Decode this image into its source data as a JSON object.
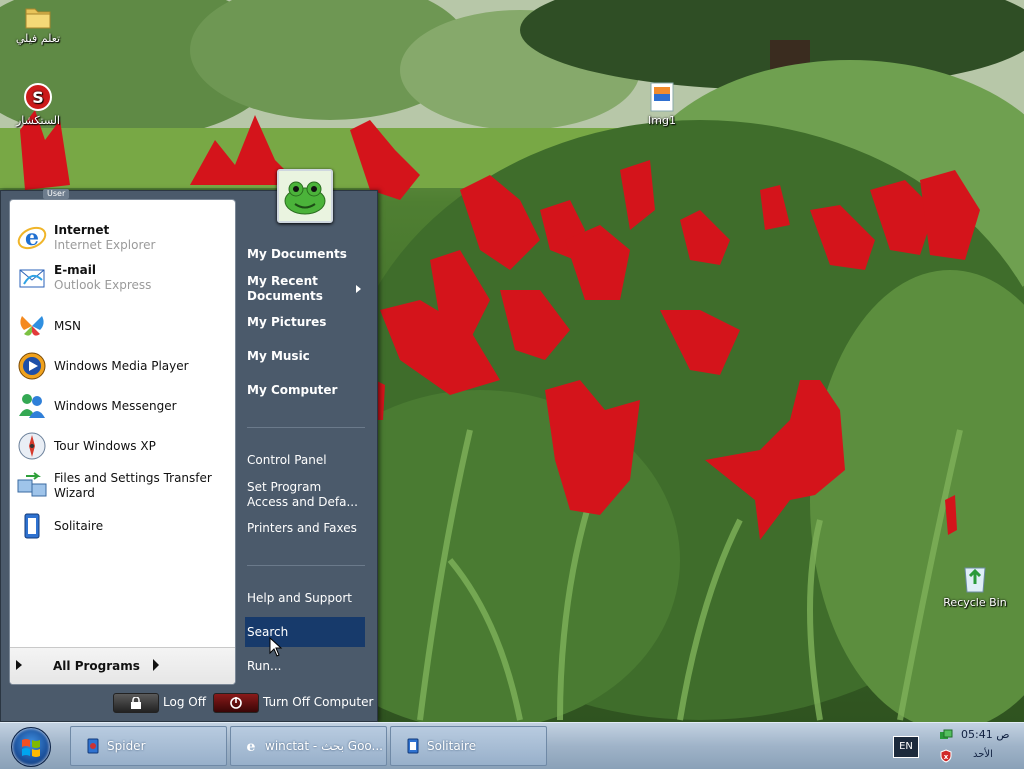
{
  "desktop": {
    "icons": [
      {
        "label": "تعلم فيلي",
        "icon": "folder-icon"
      },
      {
        "label": "الستكشار",
        "icon": "spider-app-icon"
      },
      {
        "label": "Img1",
        "icon": "image-file-icon"
      },
      {
        "label": "Recycle Bin",
        "icon": "recycle-bin-icon"
      }
    ]
  },
  "start_menu": {
    "user_name": "User",
    "pinned": [
      {
        "title": "Internet",
        "subtitle": "Internet Explorer",
        "icon": "internet-explorer-icon"
      },
      {
        "title": "E-mail",
        "subtitle": "Outlook Express",
        "icon": "outlook-express-icon"
      }
    ],
    "recent": [
      {
        "label": "MSN",
        "icon": "msn-butterfly-icon"
      },
      {
        "label": "Windows Media Player",
        "icon": "media-player-icon"
      },
      {
        "label": "Windows Messenger",
        "icon": "messenger-icon"
      },
      {
        "label": "Tour Windows XP",
        "icon": "tour-icon"
      },
      {
        "label_line1": "Files and Settings Transfer",
        "label_line2": "Wizard",
        "icon": "transfer-wizard-icon"
      },
      {
        "label": "Solitaire",
        "icon": "solitaire-icon"
      }
    ],
    "all_programs": "All Programs",
    "right_pane": {
      "my_documents": "My Documents",
      "my_recent_line1": "My Recent",
      "my_recent_line2": "Documents",
      "my_pictures": "My Pictures",
      "my_music": "My Music",
      "my_computer": "My Computer",
      "control_panel": "Control Panel",
      "set_program_line1": "Set Program",
      "set_program_line2": "Access and Defa...",
      "printers": "Printers and Faxes",
      "help": "Help and Support",
      "search": "Search",
      "run": "Run..."
    },
    "log_off": "Log Off",
    "turn_off": "Turn Off Computer"
  },
  "taskbar": {
    "buttons": [
      {
        "label": "Spider",
        "icon": "spider-solitaire-icon"
      },
      {
        "label": "winctat - بحث Goo...",
        "icon": "internet-explorer-icon"
      },
      {
        "label": "Solitaire",
        "icon": "solitaire-icon"
      }
    ],
    "language": "EN",
    "clock_time": "05:41 ص",
    "clock_day": "الأحد"
  },
  "colors": {
    "menu_right_bg": "#4b5a6b",
    "search_highlight": "#173a6b",
    "taskbar": "#9fb3c8"
  }
}
